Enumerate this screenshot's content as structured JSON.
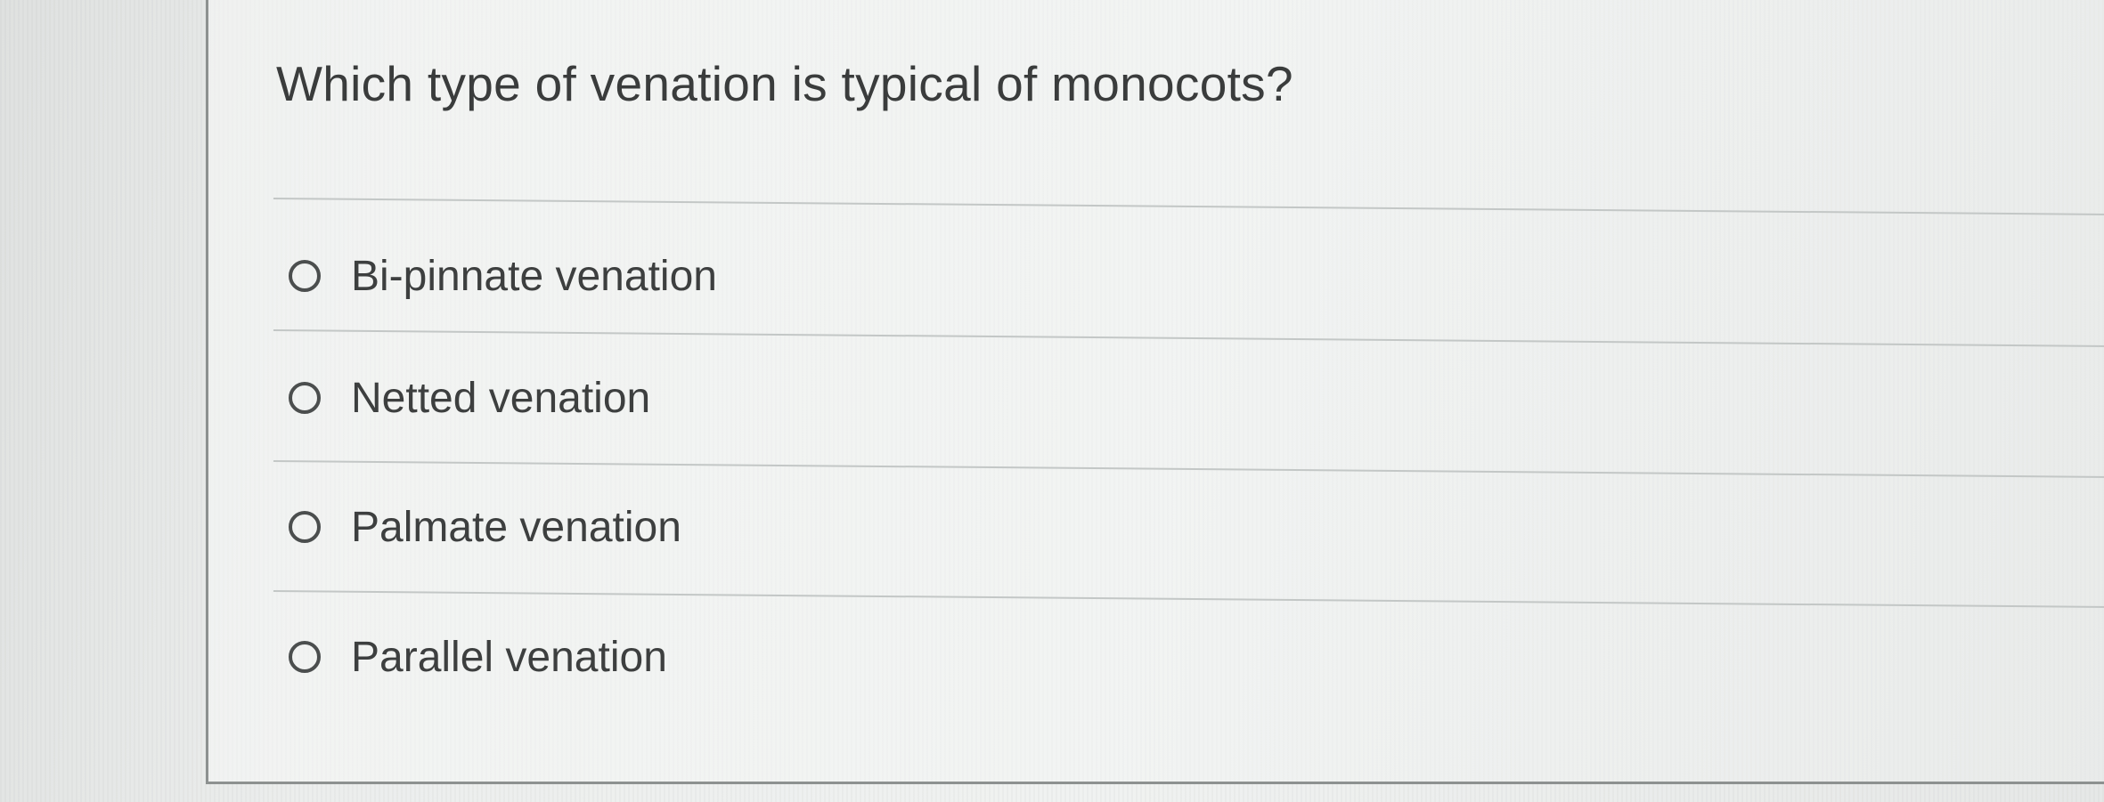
{
  "question": {
    "text": "Which type of venation is typical of monocots?"
  },
  "options": [
    {
      "label": "Bi-pinnate venation",
      "selected": false
    },
    {
      "label": "Netted venation",
      "selected": false
    },
    {
      "label": "Palmate venation",
      "selected": false
    },
    {
      "label": "Parallel venation",
      "selected": false
    }
  ],
  "colors": {
    "text": "#3a3c3c",
    "divider": "#c3c7c6",
    "radio_border": "#4b4e4e",
    "card_border": "#8d9190"
  }
}
